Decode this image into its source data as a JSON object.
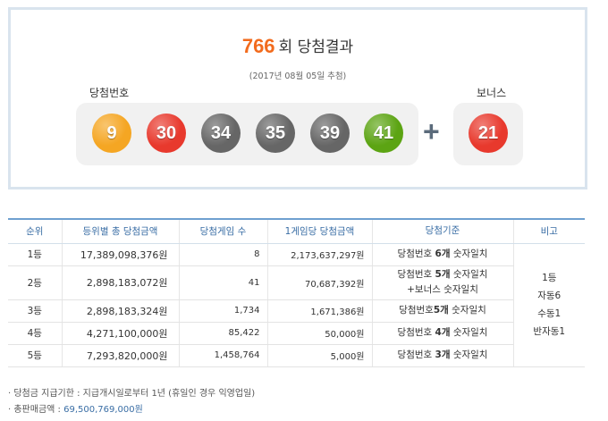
{
  "header": {
    "round_number": "766",
    "round_suffix": "회 당첨결과",
    "draw_date": "(2017년 08월 05일 추첨)",
    "winning_label": "당첨번호",
    "bonus_label": "보너스"
  },
  "numbers": [
    {
      "value": "9",
      "color": "#f5a623"
    },
    {
      "value": "30",
      "color": "#e8392d"
    },
    {
      "value": "34",
      "color": "#666666"
    },
    {
      "value": "35",
      "color": "#666666"
    },
    {
      "value": "39",
      "color": "#666666"
    },
    {
      "value": "41",
      "color": "#5ca413"
    }
  ],
  "plus_symbol": "+",
  "bonus": {
    "value": "21",
    "color": "#e8392d"
  },
  "table": {
    "headers": [
      "순위",
      "등위별 총 당첨금액",
      "당첨게임 수",
      "1게임당 당첨금액",
      "당첨기준",
      "비고"
    ],
    "rows": [
      {
        "rank": "1등",
        "total": "17,389,098,376원",
        "games": "8",
        "per_game": "2,173,637,297원",
        "criteria_a": "당첨번호 ",
        "criteria_b": "6개",
        "criteria_c": " 숫자일치"
      },
      {
        "rank": "2등",
        "total": "2,898,183,072원",
        "games": "41",
        "per_game": "70,687,392원",
        "criteria_a": "당첨번호 ",
        "criteria_b": "5개",
        "criteria_c": " 숫자일치",
        "criteria_line2": "+보너스 숫자일치"
      },
      {
        "rank": "3등",
        "total": "2,898,183,324원",
        "games": "1,734",
        "per_game": "1,671,386원",
        "criteria_a": "당첨번호",
        "criteria_b": "5개",
        "criteria_c": " 숫자일치"
      },
      {
        "rank": "4등",
        "total": "4,271,100,000원",
        "games": "85,422",
        "per_game": "50,000원",
        "criteria_a": "당첨번호 ",
        "criteria_b": "4개",
        "criteria_c": " 숫자일치"
      },
      {
        "rank": "5등",
        "total": "7,293,820,000원",
        "games": "1,458,764",
        "per_game": "5,000원",
        "criteria_a": "당첨번호 ",
        "criteria_b": "3개",
        "criteria_c": " 숫자일치"
      }
    ],
    "note_lines": [
      "1등",
      "자동6",
      "수동1",
      "반자동1"
    ]
  },
  "footnotes": {
    "deadline": "· 당첨금 지급기한 : 지급개시일로부터 1년 (휴일인 경우 익영업일)",
    "sales_label": "· 총판매금액 : ",
    "sales_value": "69,500,769,000원"
  }
}
